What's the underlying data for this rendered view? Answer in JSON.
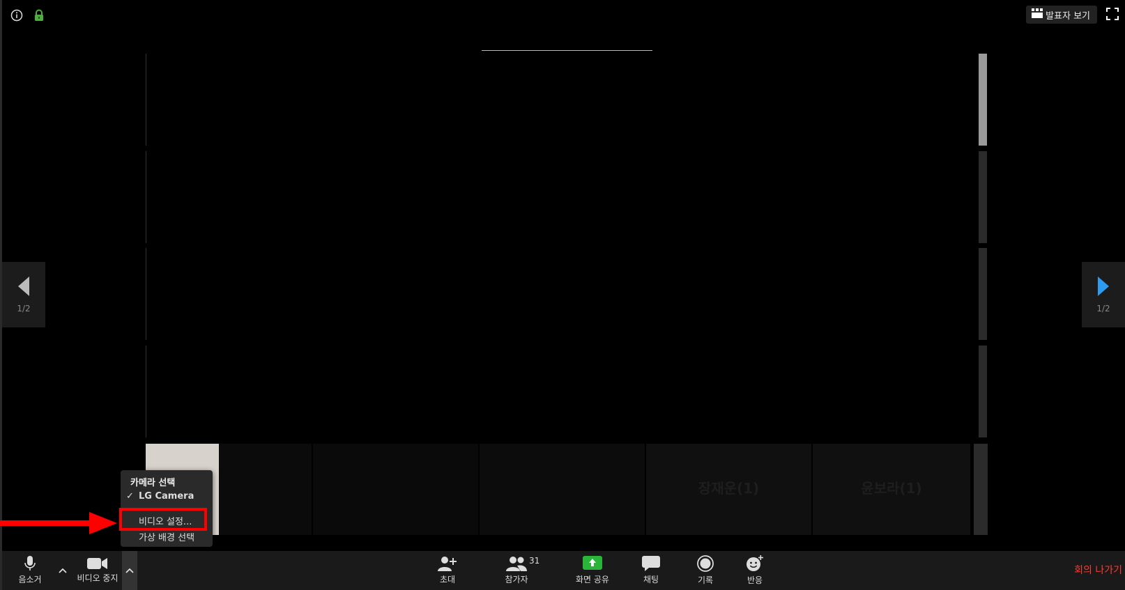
{
  "window": {
    "speaker_view_label": "발표자 보기"
  },
  "navigation": {
    "prev_page_label": "1/2",
    "next_page_label": "1/2",
    "next_arrow_color": "#2d9cf0"
  },
  "thumbnails": [
    {
      "name": ""
    },
    {
      "name": ""
    },
    {
      "name": ""
    },
    {
      "name": ""
    },
    {
      "name": "장재운(1)"
    },
    {
      "name": "윤보라(1)"
    }
  ],
  "video_menu": {
    "title": "카메라 선택",
    "selected_camera": "LG Camera",
    "video_settings": "비디오 설정...",
    "virtual_background": "가상 배경 선택"
  },
  "toolbar": {
    "mute_label": "음소거",
    "stop_video_label": "비디오 중지",
    "invite_label": "초대",
    "participants_label": "참가자",
    "participants_count": "31",
    "share_screen_label": "화면 공유",
    "chat_label": "채팅",
    "record_label": "기록",
    "reactions_label": "반응",
    "leave_label": "회의 나가기"
  },
  "colors": {
    "share_screen_green": "#2ab53a",
    "leave_red": "#ff3b30",
    "highlight_red": "#ff0000",
    "lock_green": "#4caf3a"
  }
}
